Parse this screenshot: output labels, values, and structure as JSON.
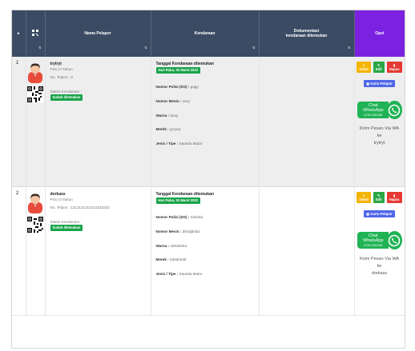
{
  "header": {
    "checkbox_glyph": "▸",
    "nama_pelapor": "Nama Pelapor",
    "kendaraan": "Kendaraan",
    "dokumentasi_line1": "Dokumentasi",
    "dokumentasi_line2": "kendaraan ditemukan",
    "opsi": "Opsi"
  },
  "colors": {
    "header": "#3c4b64",
    "opsi_header": "#7a22e0",
    "badge": "#19a34a",
    "whatsapp": "#1fb355"
  },
  "rows": [
    {
      "no": "1",
      "nama": "trytryt",
      "pria": "Pria | 0 Tahun",
      "telpon": "No. Telpon : 0",
      "status_label": "Status Kendaraan :",
      "status_badge": "Sudah ditemukan",
      "tanggal_label": "Tanggal Kendaraan ditemukan",
      "tanggal_badge": "Hari Rabu, 02 Maret 2022",
      "nopol_label": "Nomor Polisi (DS) :",
      "nopol_value": "gugy",
      "nomesin_label": "Nomor Mesin :",
      "nomesin_value": "vvvy",
      "warna_label": "Warna :",
      "warna_value": "buvy",
      "merek_label": "Merek :",
      "merek_value": "yyvyvy",
      "jenis_label": "Jenis / Tipe :",
      "jenis_value": "Sepeda Motor",
      "btn_detail": "Detail",
      "btn_edit": "Edit",
      "btn_hapus": "Hapus",
      "btn_kartu": "Kartu Pelapor",
      "wa_main": "Chat WhatsApp",
      "wa_sub": "KITA ONLINE",
      "wa_msg_line1": "Kirim Pesan Via WA ke",
      "wa_msg_line2": "trytryt"
    },
    {
      "no": "2",
      "nama": "dorkass",
      "pria": "Pria | 0 Tahun",
      "telpon": "No. Telpon : 1313131313131333333",
      "status_label": "Status Kendaraan :",
      "status_badge": "Sudah ditemukan",
      "tanggal_label": "Tanggal Kendaraan ditemukan",
      "tanggal_badge": "Hari Rabu, 02 Maret 2022",
      "nopol_label": "Nomor Polisi (DS) :",
      "nopol_value": "ndndnd",
      "nomesin_label": "Nomor Mesin :",
      "nomesin_value": "dsndjdndd",
      "warna_label": "Warna :",
      "warna_value": "ndndndnd",
      "merek_label": "Merek :",
      "merek_value": "ndndnndd",
      "jenis_label": "Jenis / Tipe :",
      "jenis_value": "Sepeda Motor",
      "btn_detail": "Detail",
      "btn_edit": "Edit",
      "btn_hapus": "Hapus",
      "btn_kartu": "Kartu Pelapor",
      "wa_main": "Chat WhatsApp",
      "wa_sub": "KITA ONLINE",
      "wa_msg_line1": "Kirim Pesan Via WA ke",
      "wa_msg_line2": "dorkass"
    }
  ]
}
